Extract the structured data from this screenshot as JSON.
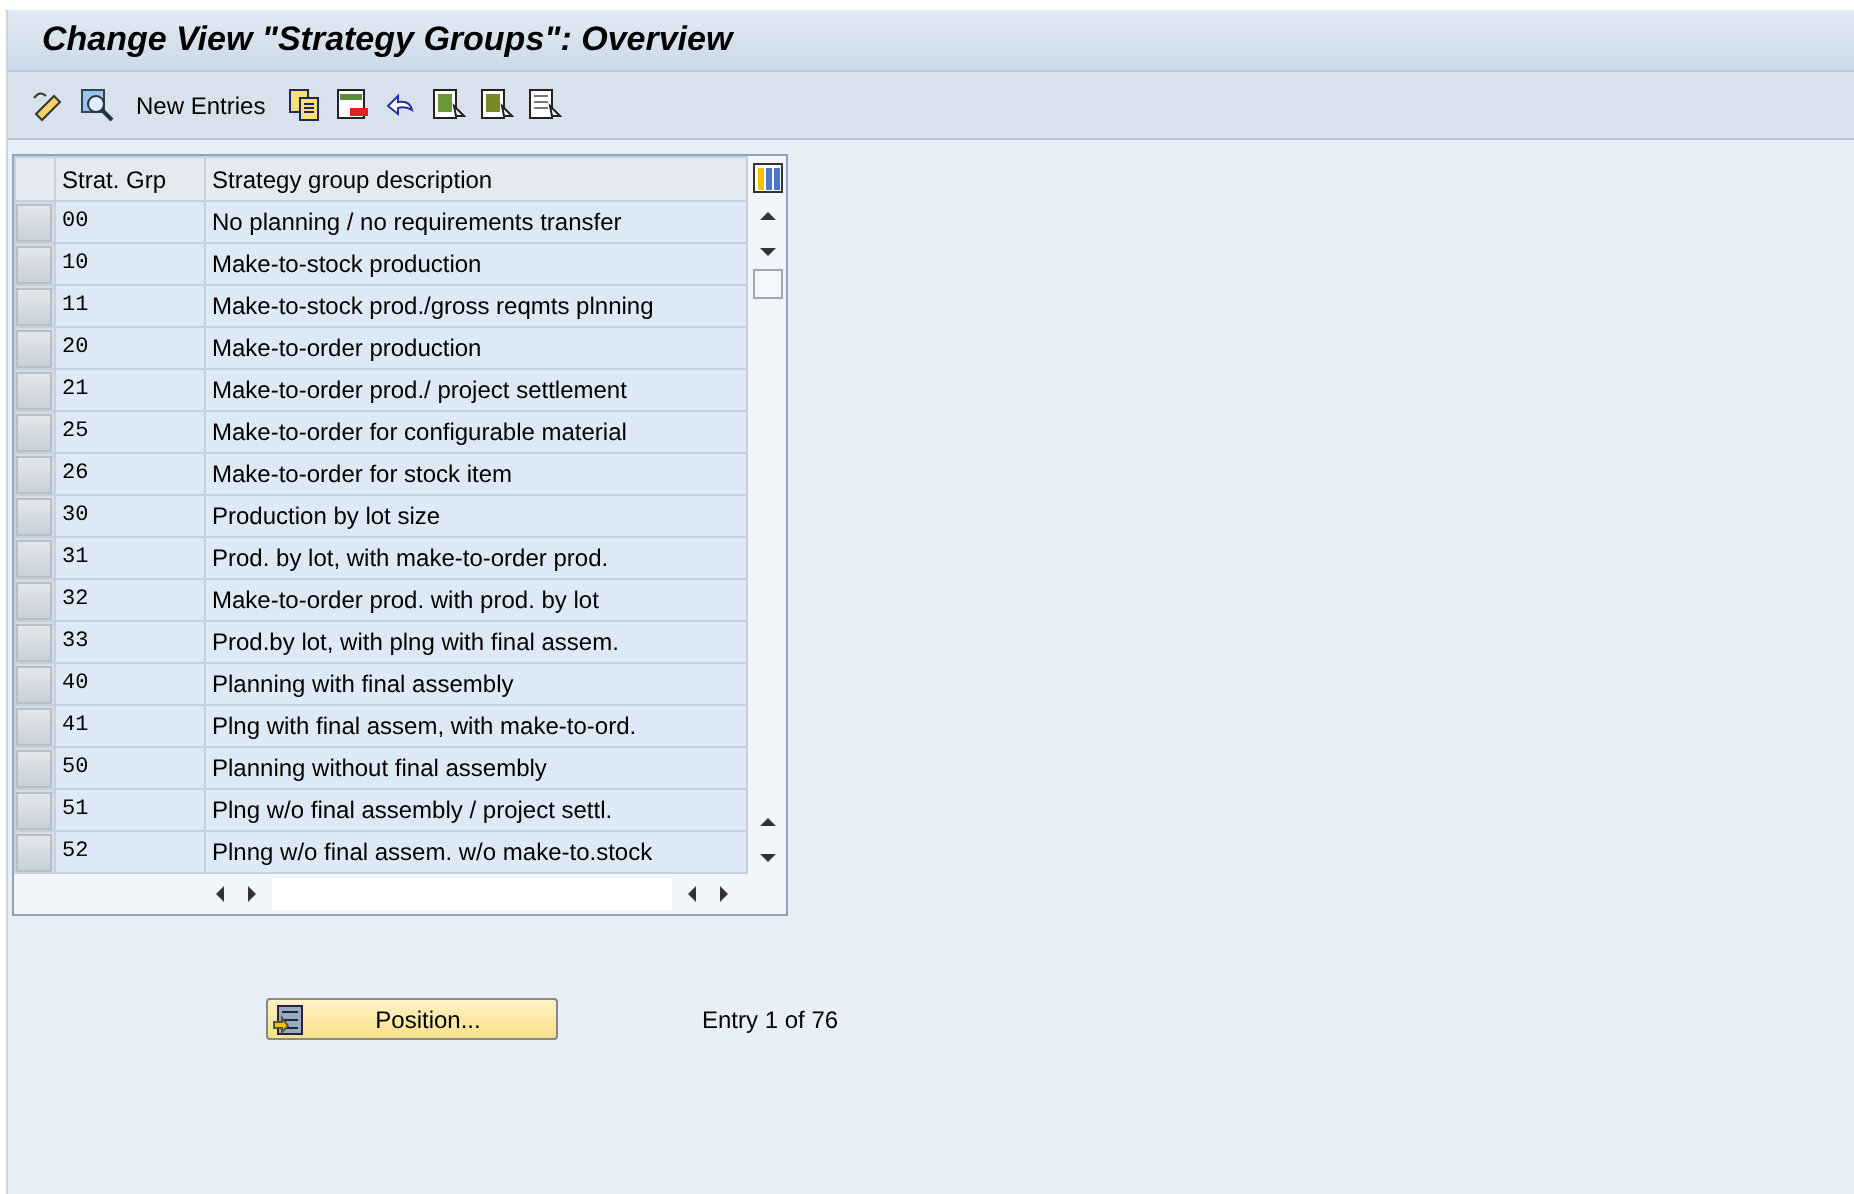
{
  "title": "Change View \"Strategy Groups\": Overview",
  "toolbar": {
    "new_entries": "New Entries"
  },
  "table": {
    "columns": [
      "Strat. Grp",
      "Strategy group description"
    ],
    "rows": [
      {
        "code": "00",
        "description": "No planning / no requirements transfer"
      },
      {
        "code": "10",
        "description": "Make-to-stock production"
      },
      {
        "code": "11",
        "description": "Make-to-stock prod./gross reqmts plnning"
      },
      {
        "code": "20",
        "description": "Make-to-order production"
      },
      {
        "code": "21",
        "description": "Make-to-order prod./ project settlement"
      },
      {
        "code": "25",
        "description": "Make-to-order for configurable material"
      },
      {
        "code": "26",
        "description": "Make-to-order for stock item"
      },
      {
        "code": "30",
        "description": "Production by lot size"
      },
      {
        "code": "31",
        "description": "Prod. by lot, with make-to-order prod."
      },
      {
        "code": "32",
        "description": "Make-to-order prod. with prod. by lot"
      },
      {
        "code": "33",
        "description": "Prod.by lot, with plng with final assem."
      },
      {
        "code": "40",
        "description": "Planning with final assembly"
      },
      {
        "code": "41",
        "description": "Plng with final assem, with make-to-ord."
      },
      {
        "code": "50",
        "description": "Planning without final assembly"
      },
      {
        "code": "51",
        "description": "Plng w/o final assembly / project settl."
      },
      {
        "code": "52",
        "description": "Plnng w/o final assem. w/o make-to.stock"
      }
    ]
  },
  "footer": {
    "position_button": "Position...",
    "entry_info": "Entry 1 of 76"
  }
}
